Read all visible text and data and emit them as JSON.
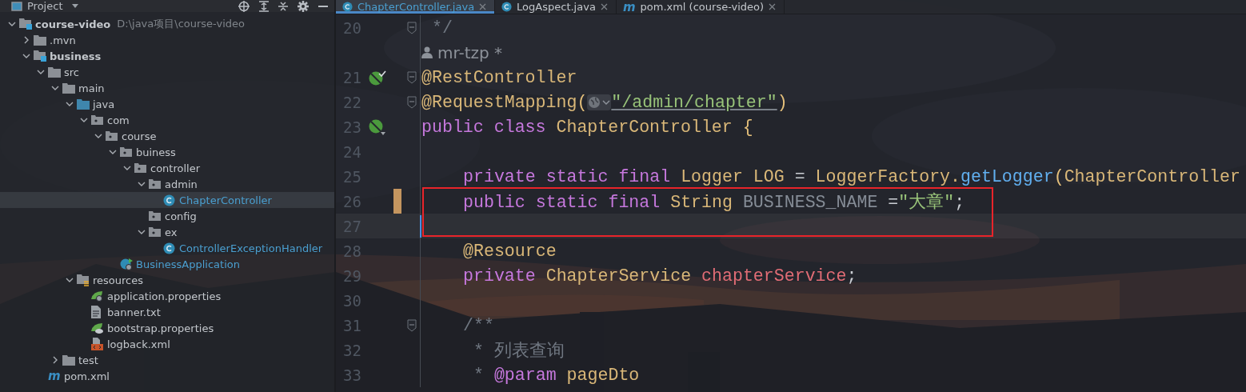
{
  "project_panel": {
    "title": "Project",
    "tree": [
      {
        "name": "course-video",
        "kind": "module",
        "bold": true,
        "path": "D:\\java项目\\course-video",
        "expanded": true,
        "children": [
          {
            "name": ".mvn",
            "kind": "folder",
            "expanded": false
          },
          {
            "name": "business",
            "kind": "module",
            "bold": true,
            "expanded": true,
            "children": [
              {
                "name": "src",
                "kind": "folder",
                "expanded": true,
                "children": [
                  {
                    "name": "main",
                    "kind": "folder",
                    "expanded": true,
                    "children": [
                      {
                        "name": "java",
                        "kind": "source",
                        "expanded": true,
                        "children": [
                          {
                            "name": "com",
                            "kind": "package",
                            "expanded": true,
                            "children": [
                              {
                                "name": "course",
                                "kind": "package",
                                "expanded": true,
                                "children": [
                                  {
                                    "name": "buiness",
                                    "kind": "package",
                                    "expanded": true,
                                    "children": [
                                      {
                                        "name": "controller",
                                        "kind": "package",
                                        "expanded": true,
                                        "children": [
                                          {
                                            "name": "admin",
                                            "kind": "package",
                                            "expanded": true,
                                            "children": [
                                              {
                                                "name": "ChapterController",
                                                "kind": "class",
                                                "modified": true,
                                                "selected": true
                                              }
                                            ]
                                          },
                                          {
                                            "name": "config",
                                            "kind": "package"
                                          },
                                          {
                                            "name": "ex",
                                            "kind": "package",
                                            "expanded": true,
                                            "children": [
                                              {
                                                "name": "ControllerExceptionHandler",
                                                "kind": "class",
                                                "modified": true,
                                                "selected": false
                                              }
                                            ]
                                          }
                                        ]
                                      }
                                    ]
                                  },
                                  {
                                    "name": "BusinessApplication",
                                    "kind": "app",
                                    "modified": true,
                                    "selected": false
                                  }
                                ]
                              }
                            ]
                          }
                        ]
                      },
                      {
                        "name": "resources",
                        "kind": "resources",
                        "expanded": true,
                        "children": [
                          {
                            "name": "application.properties",
                            "kind": "spring-config",
                            "selected": false
                          },
                          {
                            "name": "banner.txt",
                            "kind": "text",
                            "selected": false
                          },
                          {
                            "name": "bootstrap.properties",
                            "kind": "spring-cloud",
                            "selected": false
                          },
                          {
                            "name": "logback.xml",
                            "kind": "xml",
                            "selected": false
                          }
                        ]
                      }
                    ]
                  },
                  {
                    "name": "test",
                    "kind": "folder",
                    "expanded": false
                  }
                ]
              },
              {
                "name": "pom.xml",
                "kind": "maven",
                "icon_text": "m",
                "selected": false
              }
            ]
          }
        ]
      }
    ]
  },
  "tabs": [
    {
      "label": "ChapterController.java",
      "kind": "class",
      "selected": true
    },
    {
      "label": "LogAspect.java",
      "kind": "class",
      "selected": false
    },
    {
      "label": "pom.xml (course-video)",
      "kind": "maven",
      "icon_text": "m",
      "selected": false
    }
  ],
  "editor": {
    "lines": [
      {
        "number": "20",
        "fold": true,
        "tokens": [
          {
            "kind": "comment",
            "text": " */"
          }
        ]
      },
      {
        "kind": "author",
        "text": "mr-tzp *"
      },
      {
        "number": "21",
        "gutter": {
          "kind": "bean"
        },
        "fold": true,
        "tokens": [
          {
            "kind": "annotation",
            "text": "@RestController"
          }
        ]
      },
      {
        "number": "22",
        "fold": true,
        "tokens": [
          {
            "kind": "annotation",
            "text": "@RequestMapping"
          },
          {
            "kind": "paren",
            "text": "("
          },
          {
            "kind": "globe"
          },
          {
            "kind": "url",
            "text": "\"/admin/chapter\""
          },
          {
            "kind": "paren",
            "text": ")"
          }
        ]
      },
      {
        "number": "23",
        "gutter": {
          "kind": "leaf"
        },
        "tokens": [
          {
            "kind": "keyword",
            "text": "public class "
          },
          {
            "kind": "type",
            "text": "ChapterController "
          },
          {
            "kind": "paren",
            "text": "{"
          }
        ]
      },
      {
        "number": "24"
      },
      {
        "number": "25",
        "indented": true,
        "tokens": [
          {
            "kind": "keyword",
            "text": "private static final "
          },
          {
            "kind": "type",
            "text": "Logger LOG "
          },
          {
            "kind": "plain",
            "text": "= "
          },
          {
            "kind": "type",
            "text": "LoggerFactory."
          },
          {
            "kind": "method",
            "text": "getLogger"
          },
          {
            "kind": "paren",
            "text": "("
          },
          {
            "kind": "type",
            "text": "ChapterController"
          }
        ]
      },
      {
        "number": "26",
        "indented": true,
        "changed": true,
        "highlighted": true,
        "tokens": [
          {
            "kind": "keyword",
            "text": "public static final "
          },
          {
            "kind": "type",
            "text": "String "
          },
          {
            "kind": "constant",
            "text": "BUSINESS_NAME "
          },
          {
            "kind": "plain",
            "text": "="
          },
          {
            "kind": "string",
            "text": "\"大章\""
          },
          {
            "kind": "plain",
            "text": ";"
          }
        ]
      },
      {
        "number": "27",
        "current": true,
        "highlighted": true
      },
      {
        "number": "28",
        "indented": true,
        "tokens": [
          {
            "kind": "annotation",
            "text": "@Resource"
          }
        ]
      },
      {
        "number": "29",
        "indented": true,
        "tokens": [
          {
            "kind": "keyword",
            "text": "private "
          },
          {
            "kind": "type",
            "text": "ChapterService "
          },
          {
            "kind": "field",
            "text": "chapterService"
          },
          {
            "kind": "plain",
            "text": ";"
          }
        ]
      },
      {
        "number": "30"
      },
      {
        "number": "31",
        "fold": true,
        "indented": true,
        "tokens": [
          {
            "kind": "comment",
            "text": "/**"
          }
        ]
      },
      {
        "number": "32",
        "indented": true,
        "tokens": [
          {
            "kind": "comment",
            "text": " * 列表查询"
          }
        ]
      },
      {
        "number": "33",
        "indented": true,
        "tokens": [
          {
            "kind": "comment",
            "text": " * "
          },
          {
            "kind": "doctag",
            "text": "@param"
          },
          {
            "kind": "docparam",
            "text": " pageDto"
          }
        ]
      }
    ]
  }
}
